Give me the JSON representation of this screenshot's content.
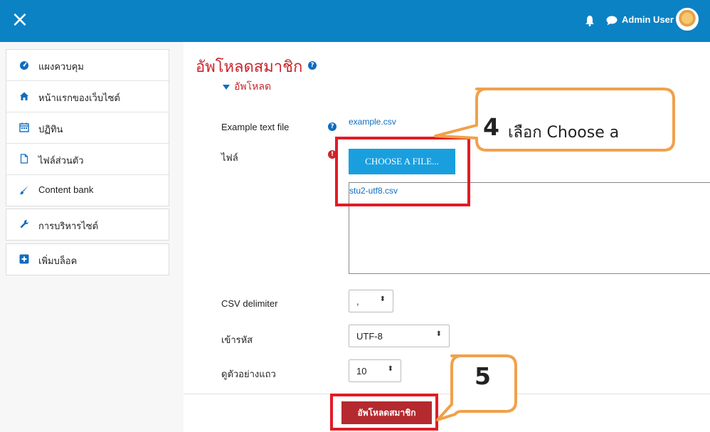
{
  "topbar": {
    "close_icon": "×",
    "user_name": "Admin User"
  },
  "sidebar": {
    "items": [
      {
        "label": "แผงควบคุม",
        "icon": "dashboard-icon"
      },
      {
        "label": "หน้าแรกของเว็บไซต์",
        "icon": "home-icon"
      },
      {
        "label": "ปฏิทิน",
        "icon": "calendar-icon"
      },
      {
        "label": "ไฟล์ส่วนตัว",
        "icon": "file-icon"
      },
      {
        "label": "Content bank",
        "icon": "brush-icon"
      },
      {
        "label": "การบริหารไซต์",
        "icon": "wrench-icon"
      },
      {
        "label": "เพิ่มบล็อค",
        "icon": "plus-square-icon"
      }
    ]
  },
  "main": {
    "page_title": "อัพโหลดสมาชิก",
    "section_title": "อัพโหลด",
    "example_label": "Example text file",
    "example_link": "example.csv",
    "file_label": "ไฟล์",
    "choose_button": "CHOOSE A FILE...",
    "uploaded_file": "stu2-utf8.csv",
    "csv_delimiter_label": "CSV delimiter",
    "csv_delimiter_value": ",",
    "encoding_label": "เข้ารหัส",
    "encoding_value": "UTF-8",
    "preview_rows_label": "ดูตัวอย่างแถว",
    "preview_rows_value": "10",
    "submit_button": "อัพโหลดสมาชิก"
  },
  "annotations": {
    "callout_4_number": "4",
    "callout_4_text": "เลือก Choose a",
    "callout_5_number": "5"
  },
  "colors": {
    "topbar": "#0b82c4",
    "title_red": "#c7282e",
    "choose_button": "#1a9fde",
    "submit_button": "#b42a2f",
    "highlight_red": "#e21b25",
    "callout_orange": "#f0a14b"
  }
}
